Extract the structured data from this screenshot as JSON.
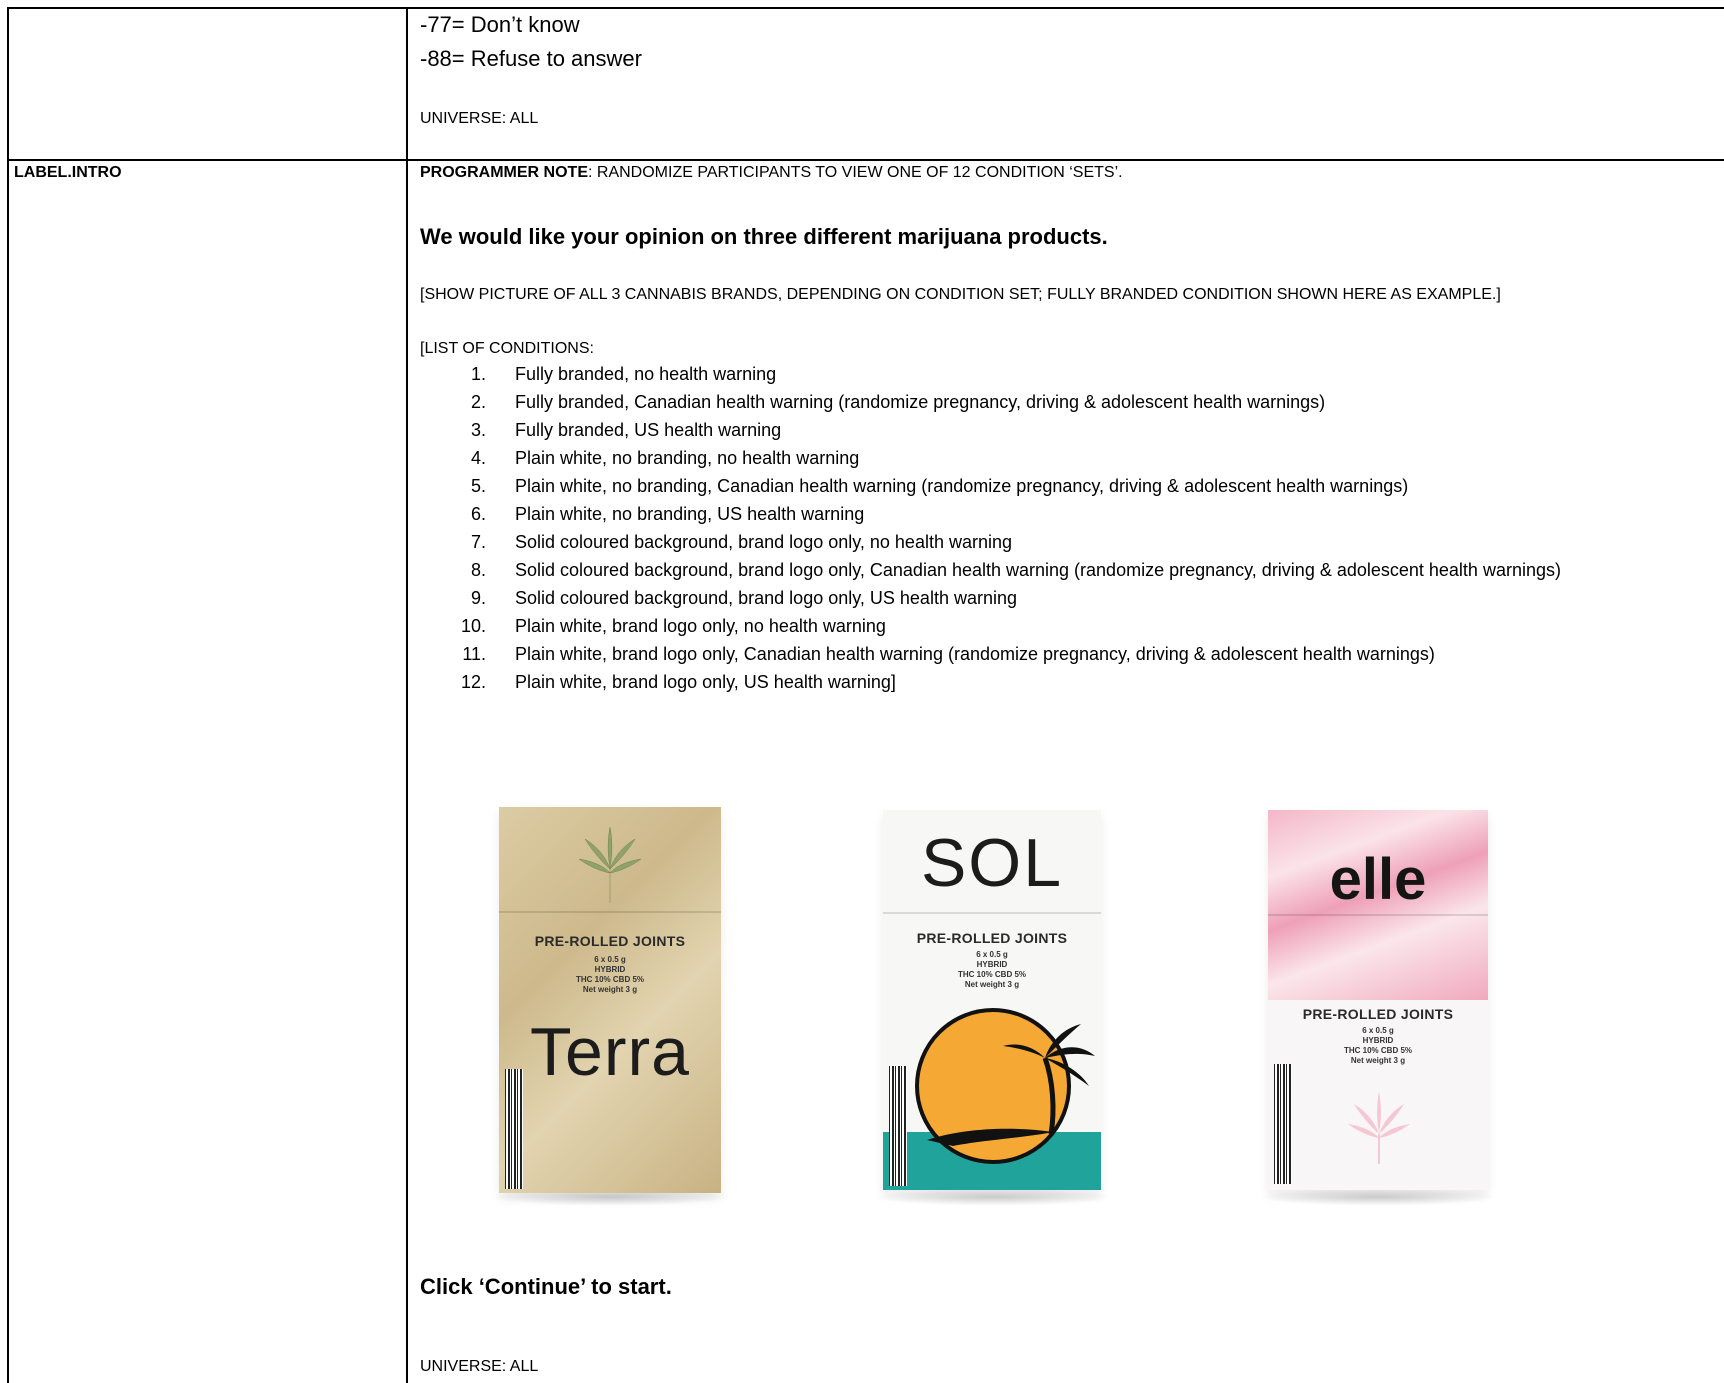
{
  "row_top": {
    "line1": "-77= Don’t know",
    "line2": "-88= Refuse to answer",
    "universe": "UNIVERSE: ALL"
  },
  "row_intro": {
    "label": "LABEL.INTRO",
    "programmer_note_label": "PROGRAMMER NOTE",
    "programmer_note_text": ": RANDOMIZE PARTICIPANTS TO VIEW ONE OF 12 CONDITION ‘SETS’.",
    "heading": "We would like your opinion on three different marijuana products.",
    "show_picture": "[SHOW PICTURE OF ALL 3 CANNABIS BRANDS, DEPENDING ON CONDITION SET; FULLY BRANDED CONDITION SHOWN HERE AS EXAMPLE.]",
    "list_header": "[LIST OF CONDITIONS:",
    "conditions": [
      {
        "num": "1.",
        "text": "Fully branded, no health warning"
      },
      {
        "num": "2.",
        "text": "Fully branded, Canadian health warning (randomize pregnancy, driving & adolescent health warnings)"
      },
      {
        "num": "3.",
        "text": "Fully branded, US health warning"
      },
      {
        "num": "4.",
        "text": "Plain white, no branding, no health warning"
      },
      {
        "num": "5.",
        "text": "Plain white, no branding, Canadian health warning  (randomize pregnancy, driving & adolescent health warnings)"
      },
      {
        "num": "6.",
        "text": "Plain white, no branding, US health warning"
      },
      {
        "num": "7.",
        "text": "Solid coloured background, brand logo only, no health warning"
      },
      {
        "num": "8.",
        "text": "Solid coloured background, brand logo only, Canadian health warning (randomize pregnancy, driving & adolescent health warnings)"
      },
      {
        "num": "9.",
        "text": "Solid coloured background, brand logo only, US health warning"
      },
      {
        "num": "10.",
        "text": "Plain white, brand logo only, no health warning"
      },
      {
        "num": "11.",
        "text": "Plain white, brand logo only, Canadian health warning (randomize pregnancy, driving & adolescent health warnings)"
      },
      {
        "num": "12.",
        "text": "Plain white, brand logo only, US health warning]"
      }
    ],
    "packs": {
      "pack_title": "PRE-ROLLED JOINTS",
      "pack_line1": "6 x 0.5 g",
      "pack_line2": "HYBRID",
      "pack_line3": "THC 10% CBD 5%",
      "pack_line4": "Net weight 3 g",
      "terra": {
        "brand": "Terra",
        "color": "#d9c9a1"
      },
      "sol": {
        "brand": "SOL",
        "sun_color": "#f5a833",
        "sea_color": "#20a39a"
      },
      "elle": {
        "brand": "elle",
        "color": "#f0a9bf"
      }
    },
    "continue_text": "Click ‘Continue’ to start.",
    "universe": "UNIVERSE: ALL"
  }
}
